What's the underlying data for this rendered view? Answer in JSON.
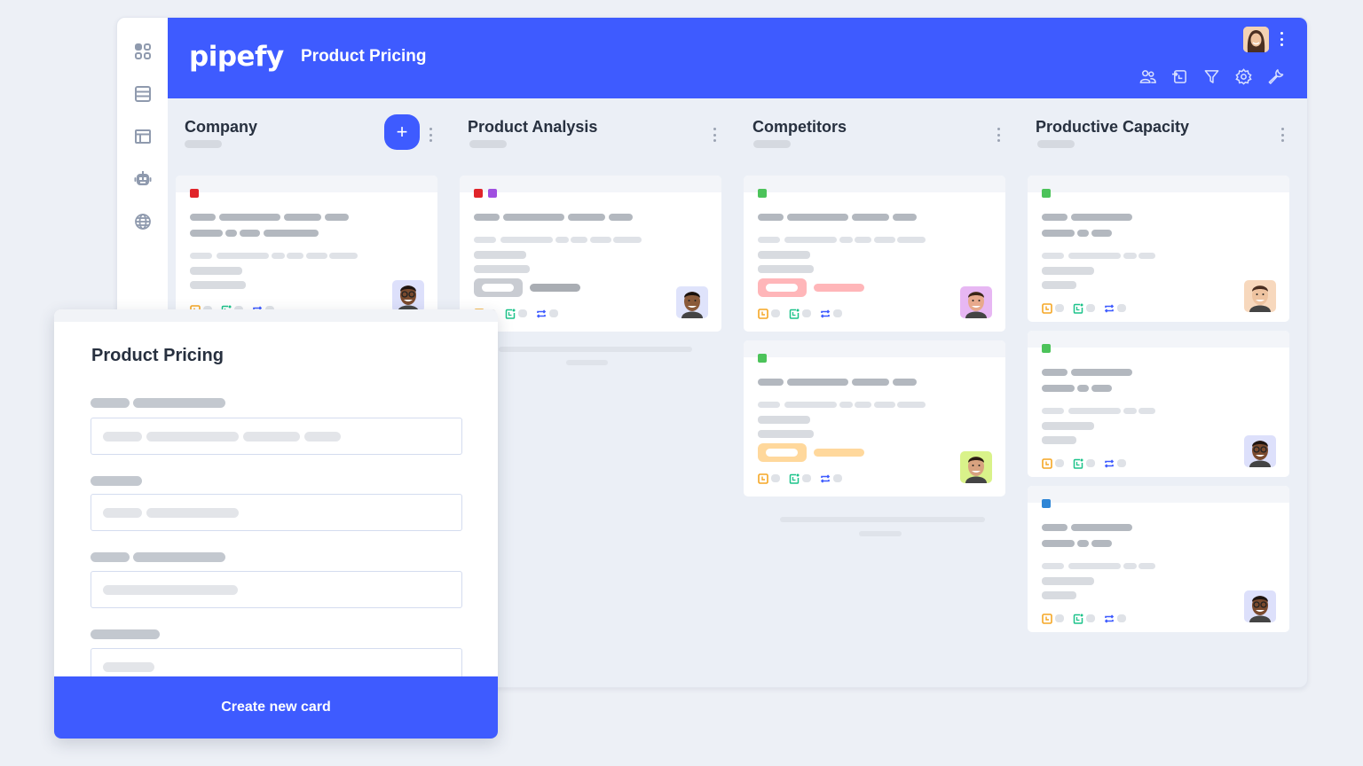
{
  "app": {
    "logo": "pipefy",
    "pipe_title": "Product Pricing",
    "brand_color": "#3e5bff"
  },
  "sidebar": {
    "items": [
      {
        "icon": "apps-grid-icon"
      },
      {
        "icon": "database-icon"
      },
      {
        "icon": "layout-icon"
      },
      {
        "icon": "robot-icon"
      },
      {
        "icon": "globe-icon"
      }
    ]
  },
  "header": {
    "tools": [
      {
        "icon": "members-icon"
      },
      {
        "icon": "import-icon"
      },
      {
        "icon": "filter-icon"
      },
      {
        "icon": "settings-icon"
      },
      {
        "icon": "wrench-icon"
      }
    ]
  },
  "phases": [
    {
      "title": "Company"
    },
    {
      "title": "Product Analysis"
    },
    {
      "title": "Competitors"
    },
    {
      "title": "Productive Capacity"
    }
  ],
  "tag_colors": {
    "red": "#e0242a",
    "purple": "#a04fe0",
    "green": "#4cc35a",
    "blue": "#2f86d6"
  },
  "modal": {
    "title": "Product Pricing",
    "create_button": "Create new card"
  }
}
